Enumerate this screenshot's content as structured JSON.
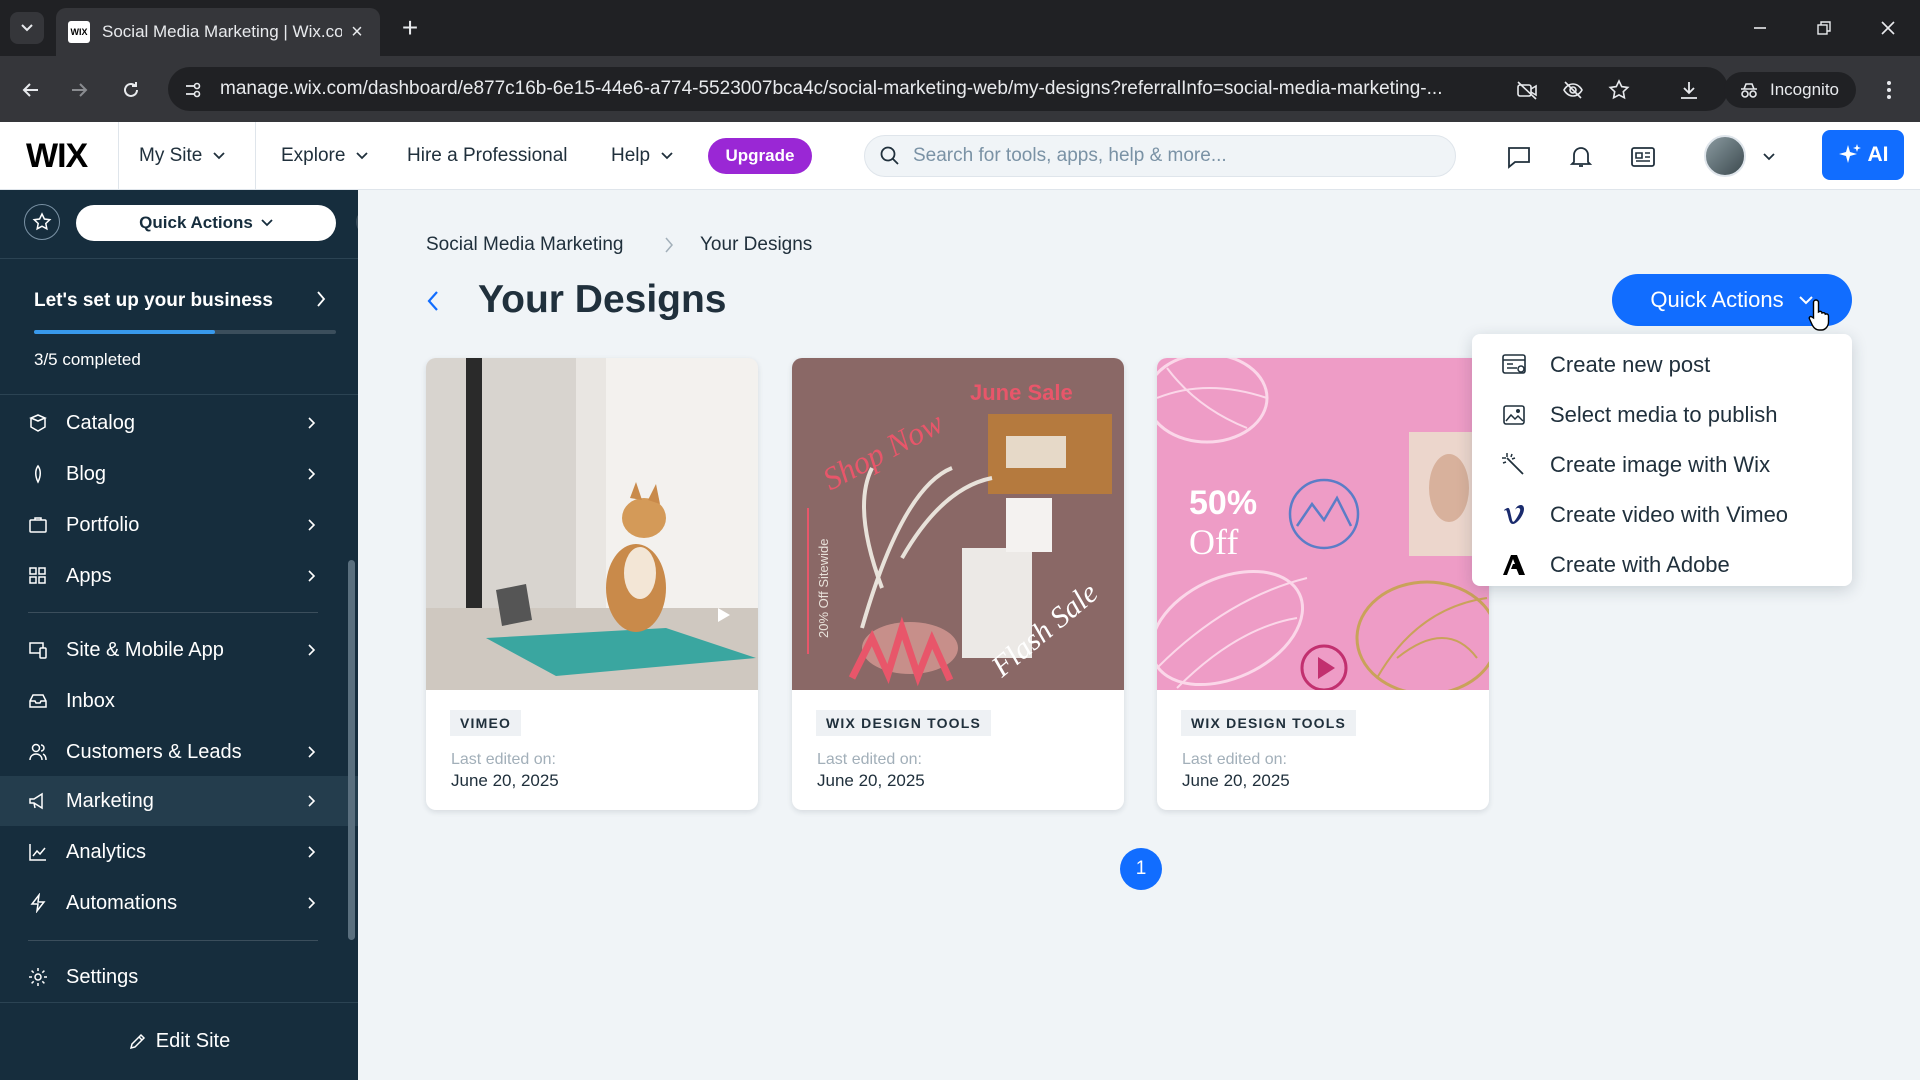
{
  "browser": {
    "tab_title": "Social Media Marketing | Wix.com",
    "favicon_text": "WIX",
    "url": "manage.wix.com/dashboard/e877c16b-6e15-44e6-a774-5523007bca4c/social-marketing-web/my-designs?referralInfo=social-media-marketing-...",
    "incognito_label": "Incognito"
  },
  "topbar": {
    "logo": "WIX",
    "my_site": "My Site",
    "explore": "Explore",
    "hire": "Hire a Professional",
    "help": "Help",
    "upgrade": "Upgrade",
    "search_placeholder": "Search for tools, apps, help & more...",
    "ai_label": "AI"
  },
  "sidebar": {
    "quick_actions": "Quick Actions",
    "setup_title": "Let's set up your business",
    "setup_progress": "3/5 completed",
    "setup_fraction": 0.6,
    "items": [
      {
        "label": "Catalog",
        "icon": "catalog-icon",
        "chevron": true
      },
      {
        "label": "Blog",
        "icon": "blog-icon",
        "chevron": true
      },
      {
        "label": "Portfolio",
        "icon": "portfolio-icon",
        "chevron": true
      },
      {
        "label": "Apps",
        "icon": "apps-icon",
        "chevron": true
      },
      {
        "label": "Site & Mobile App",
        "icon": "site-mobile-icon",
        "chevron": true
      },
      {
        "label": "Inbox",
        "icon": "inbox-icon",
        "chevron": false
      },
      {
        "label": "Customers & Leads",
        "icon": "customers-icon",
        "chevron": true
      },
      {
        "label": "Marketing",
        "icon": "marketing-icon",
        "chevron": true,
        "active": true
      },
      {
        "label": "Analytics",
        "icon": "analytics-icon",
        "chevron": true
      },
      {
        "label": "Automations",
        "icon": "automations-icon",
        "chevron": true
      },
      {
        "label": "Settings",
        "icon": "settings-icon",
        "chevron": false
      }
    ],
    "edit_site": "Edit Site"
  },
  "main": {
    "breadcrumb": [
      "Social Media Marketing",
      "Your Designs"
    ],
    "title": "Your Designs",
    "quick_actions": "Quick Actions",
    "designs": [
      {
        "source": "VIMEO",
        "edited_label": "Last edited on:",
        "date": "June 20, 2025"
      },
      {
        "source": "WIX DESIGN TOOLS",
        "edited_label": "Last edited on:",
        "date": "June 20, 2025",
        "art": {
          "shop_now": "Shop Now",
          "june_sale": "June Sale",
          "side_text": "20% Off Sitewide",
          "flash_sale": "Flash Sale"
        }
      },
      {
        "source": "WIX DESIGN TOOLS",
        "edited_label": "Last edited on:",
        "date": "June 20, 2025",
        "art": {
          "percent": "50%",
          "off": "Off"
        }
      }
    ],
    "page": "1"
  },
  "quick_actions_menu": [
    {
      "label": "Create new post",
      "icon": "new-post-icon"
    },
    {
      "label": "Select media to publish",
      "icon": "media-icon"
    },
    {
      "label": "Create image with Wix",
      "icon": "magic-wand-icon"
    },
    {
      "label": "Create video with Vimeo",
      "icon": "vimeo-icon"
    },
    {
      "label": "Create with Adobe",
      "icon": "adobe-icon"
    }
  ],
  "colors": {
    "accent": "#116dff",
    "upgrade": "#9a27d5",
    "sidebar": "#162d3d"
  }
}
